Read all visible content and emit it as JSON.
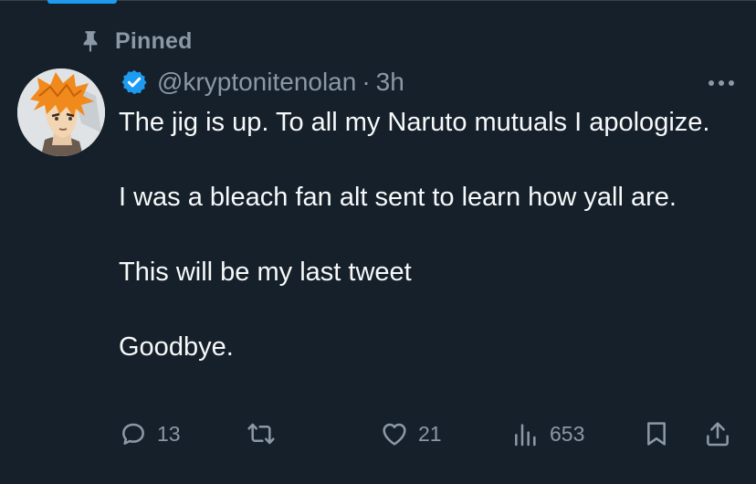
{
  "pinned": {
    "label": "Pinned"
  },
  "tweet": {
    "handle": "@kryptonitenolan",
    "separator": "·",
    "time": "3h",
    "verified": true,
    "avatar_icon": "anime-character-avatar",
    "paragraphs": [
      "The jig is up. To all my Naruto mutuals I apologize.",
      "I was a bleach fan alt sent to learn how yall are.",
      "This will be my last tweet",
      "Goodbye."
    ]
  },
  "actions": {
    "replies": "13",
    "retweets": "",
    "likes": "21",
    "views": "653"
  },
  "colors": {
    "background": "#15202b",
    "text": "#f7f9f9",
    "muted": "#8b98a5",
    "accent": "#1d9bf0",
    "border": "#38444d"
  },
  "icons": [
    "pin-icon",
    "verified-badge-icon",
    "more-options-icon",
    "reply-icon",
    "retweet-icon",
    "like-icon",
    "views-icon",
    "bookmark-icon",
    "share-icon"
  ]
}
